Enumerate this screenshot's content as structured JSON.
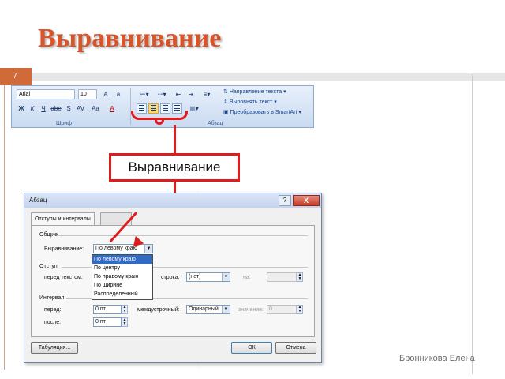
{
  "slide": {
    "title": "Выравнивание",
    "number": "7",
    "author": "Бронникова Елена",
    "callout": "Выравнивание",
    "accent_color": "#d8552b",
    "annotation_color": "#e01b1b"
  },
  "ribbon": {
    "font_name": "Arial",
    "font_size": "10",
    "font_group": "Шрифт",
    "paragraph_group": "Абзац",
    "text_direction": "Направление текста",
    "align_text": "Выровнять текст",
    "smartart": "Преобразовать в SmartArt",
    "bold": "Ж",
    "italic": "К",
    "underline": "Ч",
    "strike": "abe",
    "shadow": "S",
    "spacing": "AV",
    "change_case": "Aa",
    "font_color": "A"
  },
  "dialog": {
    "title": "Абзац",
    "help": "?",
    "close": "X",
    "tabs": [
      "Отступы и интервалы",
      ""
    ],
    "general_section": "Общие",
    "alignment_label": "Выравнивание:",
    "alignment_value": "По левому краю",
    "alignment_options": [
      "По левому краю",
      "По центру",
      "По правому краю",
      "По ширине",
      "Распределенный"
    ],
    "indent_section": "Отступ",
    "before_text_label": "перед текстом:",
    "first_line_label": "строка:",
    "first_line_value": "(нет)",
    "by_label": "на:",
    "spacing_section": "Интервал",
    "before_label": "перед:",
    "before_value": "0 пт",
    "after_label": "после:",
    "after_value": "0 пт",
    "line_spacing_label": "междустрочный:",
    "line_spacing_value": "Одинарный",
    "value_label": "значение:",
    "value_value": "0",
    "tabs_button": "Табуляция...",
    "ok_button": "ОК",
    "cancel_button": "Отмена"
  }
}
